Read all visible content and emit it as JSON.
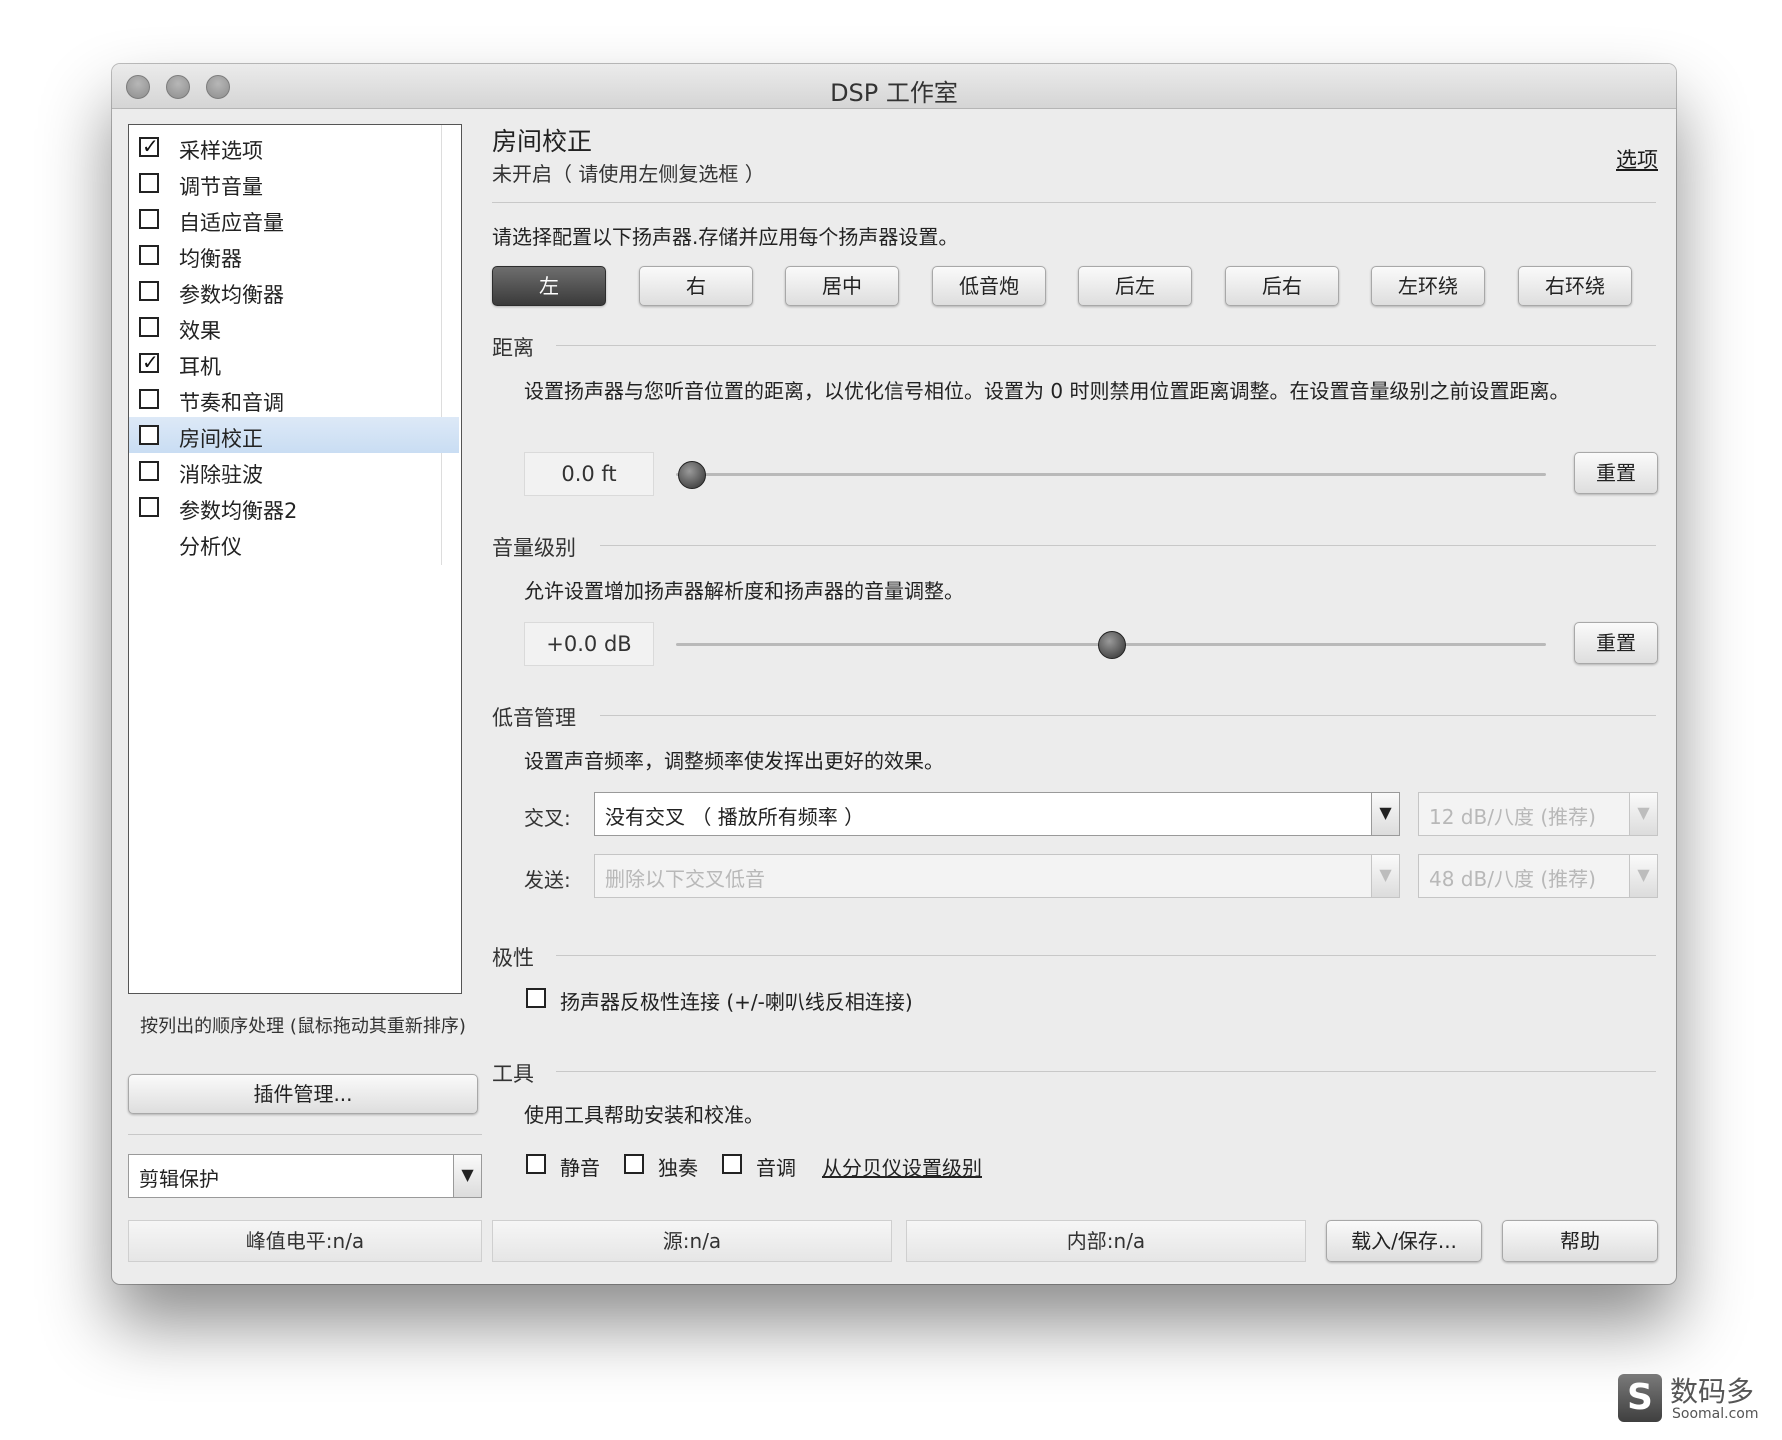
{
  "window": {
    "title": "DSP 工作室"
  },
  "sidebar": {
    "items": [
      {
        "label": "采样选项",
        "checked": true
      },
      {
        "label": "调节音量",
        "checked": false
      },
      {
        "label": "自适应音量",
        "checked": false
      },
      {
        "label": "均衡器",
        "checked": false
      },
      {
        "label": "参数均衡器",
        "checked": false
      },
      {
        "label": "效果",
        "checked": false
      },
      {
        "label": "耳机",
        "checked": true
      },
      {
        "label": "节奏和音调",
        "checked": false
      },
      {
        "label": "房间校正",
        "checked": false,
        "selected": true
      },
      {
        "label": "消除驻波",
        "checked": false
      },
      {
        "label": "参数均衡器2",
        "checked": false
      },
      {
        "label": "分析仪"
      }
    ],
    "hint": "按列出的顺序处理 (鼠标拖动其重新排序)",
    "plugin_button": "插件管理...",
    "clip_select": "剪辑保护"
  },
  "main": {
    "title": "房间校正",
    "subtitle": "未开启（ 请使用左侧复选框 ）",
    "options_link": "选项",
    "speaker_prompt": "请选择配置以下扬声器.存储并应用每个扬声器设置。",
    "speakers": [
      "左",
      "右",
      "居中",
      "低音炮",
      "后左",
      "后右",
      "左环绕",
      "右环绕"
    ],
    "active_speaker": "左",
    "distance": {
      "heading": "距离",
      "desc": "设置扬声器与您听音位置的距离，以优化信号相位。设置为 0 时则禁用位置距离调整。在设置音量级别之前设置距离。",
      "value": "0.0 ft",
      "slider_fraction": 0.0,
      "reset": "重置"
    },
    "volume": {
      "heading": "音量级别",
      "desc": "允许设置增加扬声器解析度和扬声器的音量调整。",
      "value": "+0.0 dB",
      "slider_fraction": 0.5,
      "reset": "重置"
    },
    "bass": {
      "heading": "低音管理",
      "desc": "设置声音频率，调整频率使发挥出更好的效果。",
      "crossover_label": "交叉:",
      "crossover_value": "没有交叉 （ 播放所有频率 ）",
      "crossover_slope": "12 dB/八度 (推荐)",
      "send_label": "发送:",
      "send_value": "删除以下交叉低音",
      "send_slope": "48 dB/八度 (推荐)"
    },
    "polarity": {
      "heading": "极性",
      "checkbox": "扬声器反极性连接 (+/-喇叭线反相连接)"
    },
    "tools": {
      "heading": "工具",
      "desc": "使用工具帮助安装和校准。",
      "mute": "静音",
      "solo": "独奏",
      "tone": "音调",
      "spl_link": "从分贝仪设置级别"
    }
  },
  "status": {
    "peak": "峰值电平:n/a",
    "source": "源:n/a",
    "internal": "内部:n/a",
    "load_save": "载入/保存...",
    "help": "帮助"
  },
  "watermark": {
    "logo": "S",
    "cn": "数码多",
    "en": "Soomal.com"
  }
}
